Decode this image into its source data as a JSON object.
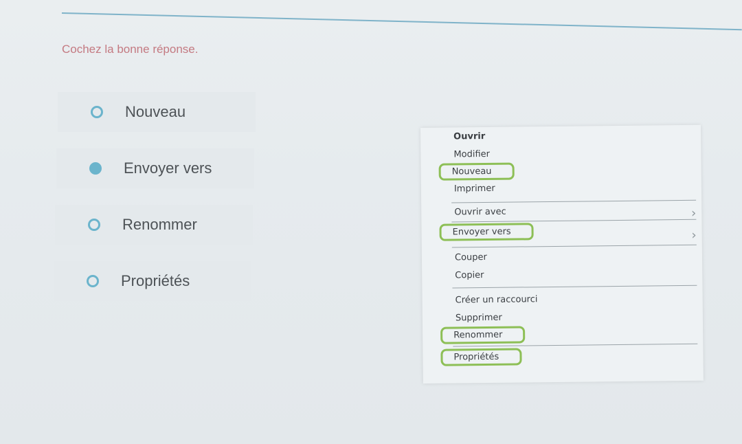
{
  "question": {
    "instruction": "Cochez la bonne réponse.",
    "options": [
      {
        "label": "Nouveau",
        "selected": false
      },
      {
        "label": "Envoyer vers",
        "selected": true
      },
      {
        "label": "Renommer",
        "selected": false
      },
      {
        "label": "Propriétés",
        "selected": false
      }
    ]
  },
  "context_menu": {
    "items": [
      {
        "label": "Ouvrir",
        "highlighted": false
      },
      {
        "label": "Modifier",
        "highlighted": false
      },
      {
        "label": "Nouveau",
        "highlighted": true
      },
      {
        "label": "Imprimer",
        "highlighted": false
      },
      {
        "label": "Ouvrir avec",
        "highlighted": false,
        "submenu": true
      },
      {
        "label": "Envoyer vers",
        "highlighted": true,
        "submenu": true
      },
      {
        "label": "Couper",
        "highlighted": false
      },
      {
        "label": "Copier",
        "highlighted": false
      },
      {
        "label": "Créer un raccourci",
        "highlighted": false
      },
      {
        "label": "Supprimer",
        "highlighted": false
      },
      {
        "label": "Renommer",
        "highlighted": true
      },
      {
        "label": "Propriétés",
        "highlighted": true
      }
    ],
    "submenu_icon": "chevron-right-icon",
    "highlight_color": "#8dbf56"
  },
  "colors": {
    "accent": "#6bb4cc",
    "instruction_text": "#c47a82"
  }
}
